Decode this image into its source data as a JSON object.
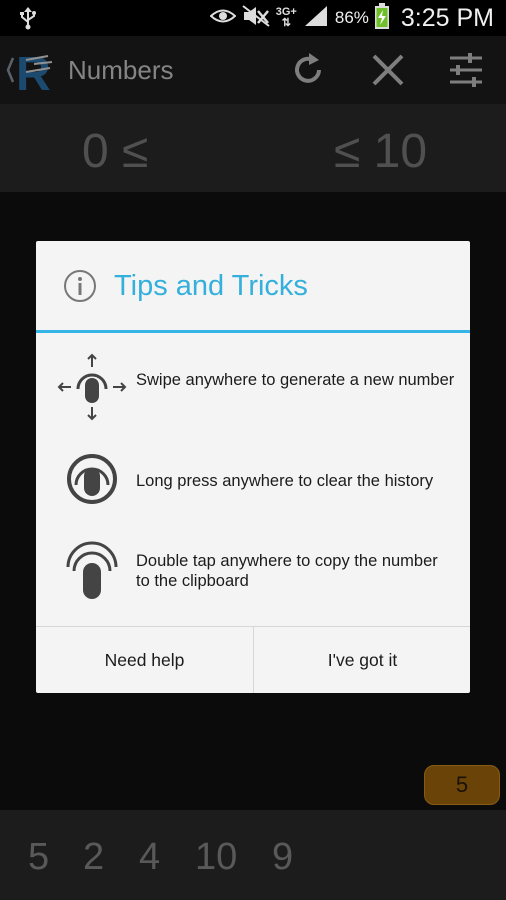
{
  "status_bar": {
    "network": "3G+",
    "battery": "86%",
    "time": "3:25 PM"
  },
  "action_bar": {
    "title": "Numbers",
    "icons": [
      "app-logo-icon",
      "refresh-icon",
      "close-icon",
      "settings-sliders-icon"
    ]
  },
  "range": {
    "min_text": "0 ≤",
    "max_text": "≤ 10"
  },
  "dialog": {
    "title": "Tips and Tricks",
    "tips": [
      {
        "icon": "swipe-gesture-icon",
        "text": "Swipe anywhere to generate a new number"
      },
      {
        "icon": "long-press-icon",
        "text": "Long press anywhere to clear the history"
      },
      {
        "icon": "double-tap-icon",
        "text": "Double tap anywhere to copy the number to the clipboard"
      }
    ],
    "buttons": {
      "help": "Need help",
      "ok": "I've got it"
    }
  },
  "current_number": "5",
  "history": [
    "5",
    "2",
    "4",
    "10",
    "9"
  ],
  "colors": {
    "accent": "#33b5e5",
    "badge": "#7a4d07"
  }
}
